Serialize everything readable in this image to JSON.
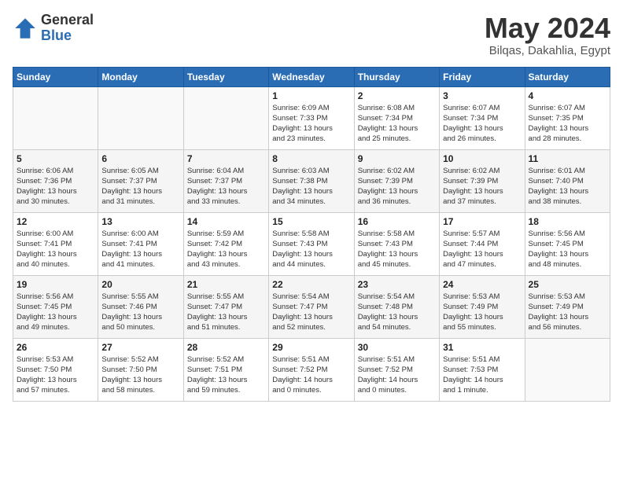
{
  "logo": {
    "general": "General",
    "blue": "Blue"
  },
  "title": {
    "month": "May 2024",
    "location": "Bilqas, Dakahlia, Egypt"
  },
  "days": [
    "Sunday",
    "Monday",
    "Tuesday",
    "Wednesday",
    "Thursday",
    "Friday",
    "Saturday"
  ],
  "weeks": [
    [
      {
        "day": null,
        "content": null
      },
      {
        "day": null,
        "content": null
      },
      {
        "day": null,
        "content": null
      },
      {
        "day": "1",
        "content": "Sunrise: 6:09 AM\nSunset: 7:33 PM\nDaylight: 13 hours\nand 23 minutes."
      },
      {
        "day": "2",
        "content": "Sunrise: 6:08 AM\nSunset: 7:34 PM\nDaylight: 13 hours\nand 25 minutes."
      },
      {
        "day": "3",
        "content": "Sunrise: 6:07 AM\nSunset: 7:34 PM\nDaylight: 13 hours\nand 26 minutes."
      },
      {
        "day": "4",
        "content": "Sunrise: 6:07 AM\nSunset: 7:35 PM\nDaylight: 13 hours\nand 28 minutes."
      }
    ],
    [
      {
        "day": "5",
        "content": "Sunrise: 6:06 AM\nSunset: 7:36 PM\nDaylight: 13 hours\nand 30 minutes."
      },
      {
        "day": "6",
        "content": "Sunrise: 6:05 AM\nSunset: 7:37 PM\nDaylight: 13 hours\nand 31 minutes."
      },
      {
        "day": "7",
        "content": "Sunrise: 6:04 AM\nSunset: 7:37 PM\nDaylight: 13 hours\nand 33 minutes."
      },
      {
        "day": "8",
        "content": "Sunrise: 6:03 AM\nSunset: 7:38 PM\nDaylight: 13 hours\nand 34 minutes."
      },
      {
        "day": "9",
        "content": "Sunrise: 6:02 AM\nSunset: 7:39 PM\nDaylight: 13 hours\nand 36 minutes."
      },
      {
        "day": "10",
        "content": "Sunrise: 6:02 AM\nSunset: 7:39 PM\nDaylight: 13 hours\nand 37 minutes."
      },
      {
        "day": "11",
        "content": "Sunrise: 6:01 AM\nSunset: 7:40 PM\nDaylight: 13 hours\nand 38 minutes."
      }
    ],
    [
      {
        "day": "12",
        "content": "Sunrise: 6:00 AM\nSunset: 7:41 PM\nDaylight: 13 hours\nand 40 minutes."
      },
      {
        "day": "13",
        "content": "Sunrise: 6:00 AM\nSunset: 7:41 PM\nDaylight: 13 hours\nand 41 minutes."
      },
      {
        "day": "14",
        "content": "Sunrise: 5:59 AM\nSunset: 7:42 PM\nDaylight: 13 hours\nand 43 minutes."
      },
      {
        "day": "15",
        "content": "Sunrise: 5:58 AM\nSunset: 7:43 PM\nDaylight: 13 hours\nand 44 minutes."
      },
      {
        "day": "16",
        "content": "Sunrise: 5:58 AM\nSunset: 7:43 PM\nDaylight: 13 hours\nand 45 minutes."
      },
      {
        "day": "17",
        "content": "Sunrise: 5:57 AM\nSunset: 7:44 PM\nDaylight: 13 hours\nand 47 minutes."
      },
      {
        "day": "18",
        "content": "Sunrise: 5:56 AM\nSunset: 7:45 PM\nDaylight: 13 hours\nand 48 minutes."
      }
    ],
    [
      {
        "day": "19",
        "content": "Sunrise: 5:56 AM\nSunset: 7:45 PM\nDaylight: 13 hours\nand 49 minutes."
      },
      {
        "day": "20",
        "content": "Sunrise: 5:55 AM\nSunset: 7:46 PM\nDaylight: 13 hours\nand 50 minutes."
      },
      {
        "day": "21",
        "content": "Sunrise: 5:55 AM\nSunset: 7:47 PM\nDaylight: 13 hours\nand 51 minutes."
      },
      {
        "day": "22",
        "content": "Sunrise: 5:54 AM\nSunset: 7:47 PM\nDaylight: 13 hours\nand 52 minutes."
      },
      {
        "day": "23",
        "content": "Sunrise: 5:54 AM\nSunset: 7:48 PM\nDaylight: 13 hours\nand 54 minutes."
      },
      {
        "day": "24",
        "content": "Sunrise: 5:53 AM\nSunset: 7:49 PM\nDaylight: 13 hours\nand 55 minutes."
      },
      {
        "day": "25",
        "content": "Sunrise: 5:53 AM\nSunset: 7:49 PM\nDaylight: 13 hours\nand 56 minutes."
      }
    ],
    [
      {
        "day": "26",
        "content": "Sunrise: 5:53 AM\nSunset: 7:50 PM\nDaylight: 13 hours\nand 57 minutes."
      },
      {
        "day": "27",
        "content": "Sunrise: 5:52 AM\nSunset: 7:50 PM\nDaylight: 13 hours\nand 58 minutes."
      },
      {
        "day": "28",
        "content": "Sunrise: 5:52 AM\nSunset: 7:51 PM\nDaylight: 13 hours\nand 59 minutes."
      },
      {
        "day": "29",
        "content": "Sunrise: 5:51 AM\nSunset: 7:52 PM\nDaylight: 14 hours\nand 0 minutes."
      },
      {
        "day": "30",
        "content": "Sunrise: 5:51 AM\nSunset: 7:52 PM\nDaylight: 14 hours\nand 0 minutes."
      },
      {
        "day": "31",
        "content": "Sunrise: 5:51 AM\nSunset: 7:53 PM\nDaylight: 14 hours\nand 1 minute."
      },
      {
        "day": null,
        "content": null
      }
    ]
  ]
}
